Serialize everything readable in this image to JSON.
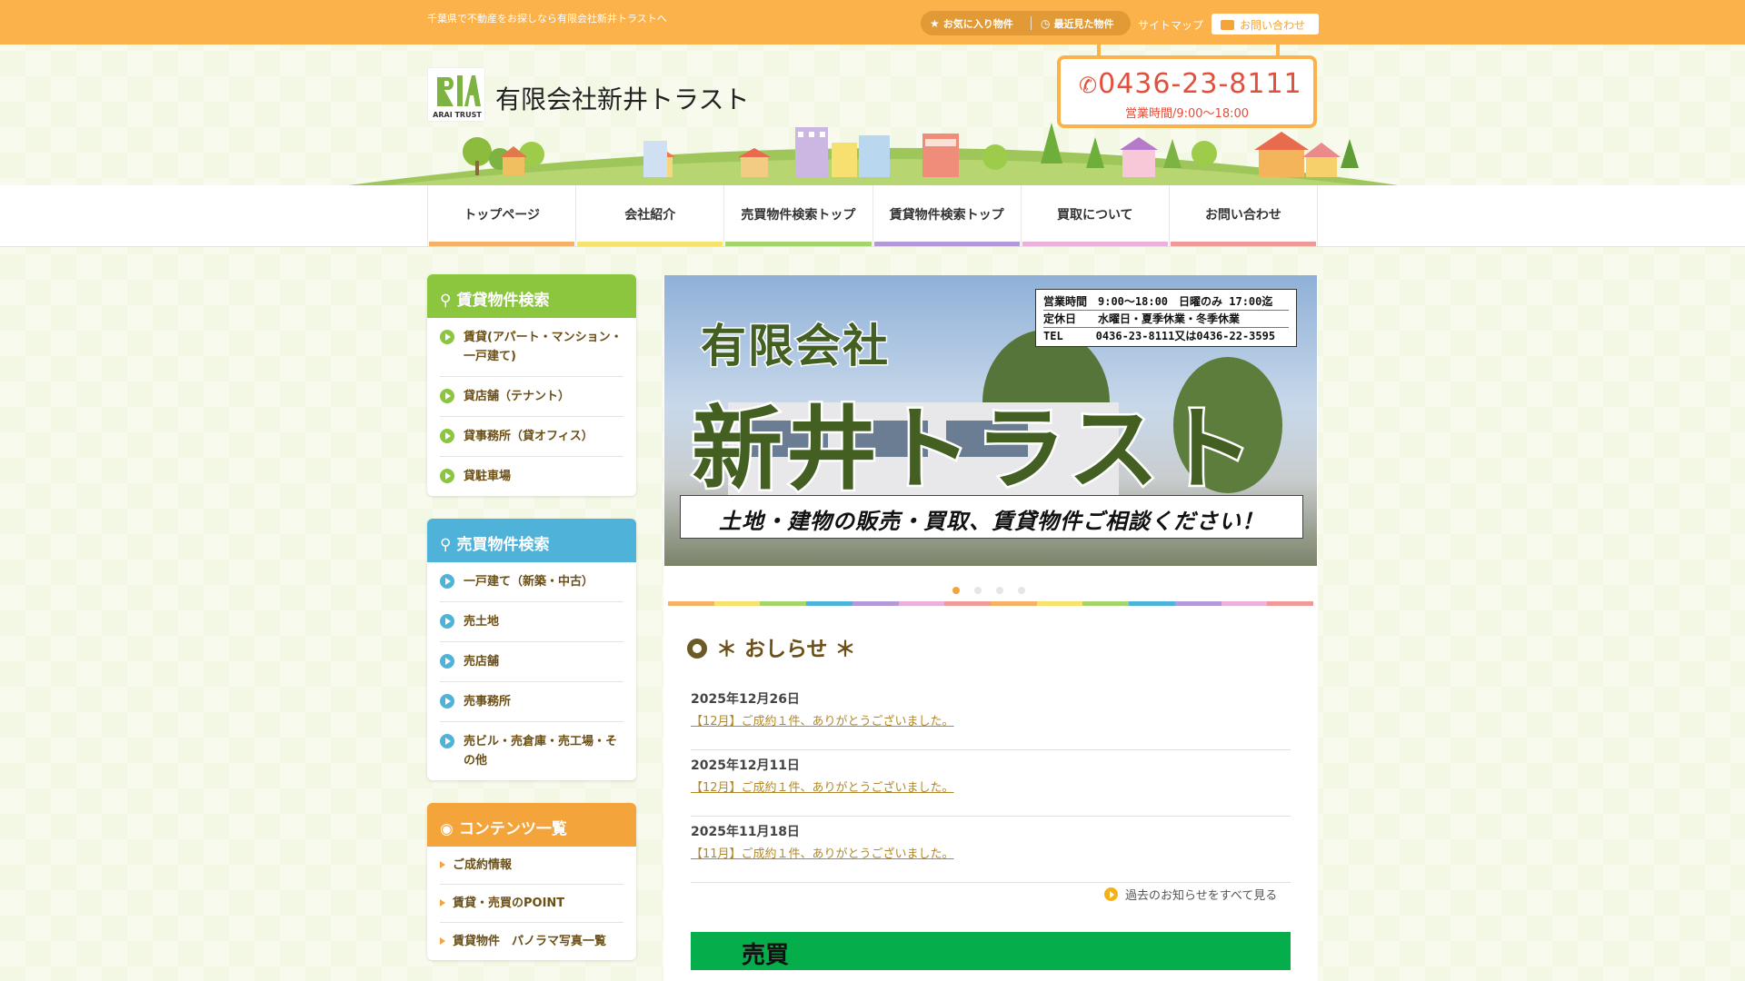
{
  "topbar": {
    "tagline": "千葉県で不動産をお探しなら有限会社新井トラストへ",
    "favorites": "お気に入り物件",
    "recent": "最近見た物件",
    "sitemap": "サイトマップ",
    "contact": "お問い合わせ"
  },
  "header": {
    "logo_text": "ARAI TRUST",
    "company": "有限会社新井トラスト",
    "phone": "0436-23-8111",
    "hours": "営業時間/9:00～18:00"
  },
  "nav": [
    {
      "label": "トップページ",
      "color": "#f6b168"
    },
    {
      "label": "会社紹介",
      "color": "#f7e36c"
    },
    {
      "label": "売買物件検索トップ",
      "color": "#a5d46c"
    },
    {
      "label": "賃貸物件検索トップ",
      "color": "#b39ad6"
    },
    {
      "label": "買取について",
      "color": "#eab1dc"
    },
    {
      "label": "お問い合わせ",
      "color": "#ef9a98"
    }
  ],
  "sidebar": {
    "rent": {
      "title": "賃貸物件検索",
      "color": "#8cc63f",
      "items": [
        "賃貸(アパート・マンション・一戸建て)",
        "貸店舗（テナント）",
        "貸事務所（貸オフィス）",
        "貸駐車場"
      ]
    },
    "sale": {
      "title": "売買物件検索",
      "color": "#4fb3d9",
      "items": [
        "一戸建て（新築・中古）",
        "売土地",
        "売店舗",
        "売事務所",
        "売ビル・売倉庫・売工場・その他"
      ]
    },
    "contents": {
      "title": "コンテンツ一覧",
      "color": "#f3a43a",
      "items": [
        "ご成約情報",
        "賃貸・売買のPOINT",
        "賃貸物件　パノラマ写真一覧"
      ]
    }
  },
  "hero": {
    "line1": "有限会社",
    "line2": "新井トラスト",
    "info": [
      "営業時間　9:00～18:00　日曜のみ 17:00迄",
      "定休日　　水曜日・夏季休業・冬季休業",
      "TEL　　　0436-23-8111又は0436-22-3595"
    ],
    "tagline": "土地・建物の販売・買取、賃貸物件ご相談ください！"
  },
  "news": {
    "title": "＊ おしらせ ＊",
    "items": [
      {
        "date": "2025年12月26日",
        "text": "【12月】ご成約１件、ありがとうございました。"
      },
      {
        "date": "2025年12月11日",
        "text": "【12月】ご成約１件、ありがとうございました。"
      },
      {
        "date": "2025年11月18日",
        "text": "【11月】ご成約１件、ありがとうございました。"
      }
    ],
    "more": "過去のお知らせをすべて見る"
  },
  "section": {
    "label": "売買"
  }
}
